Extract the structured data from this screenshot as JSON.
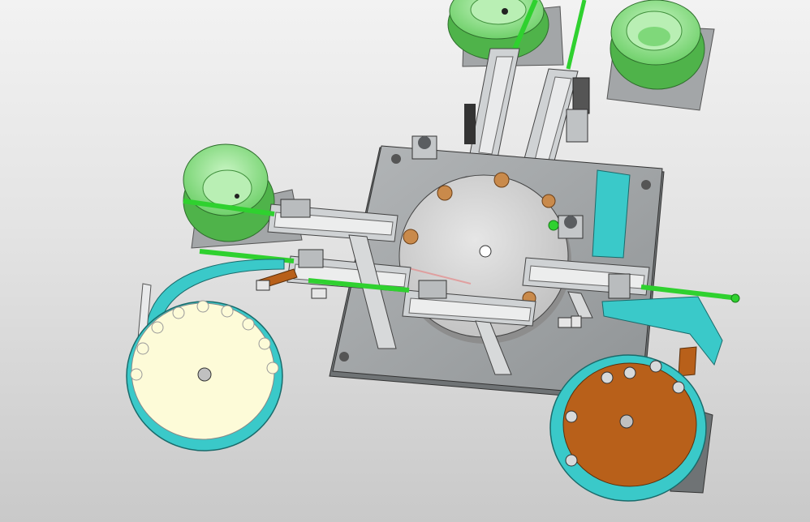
{
  "scene": {
    "subject": "",
    "colors": {
      "background_top": "#f2f2f2",
      "background_bottom": "#c9c9c9",
      "bowl_green": "#8fe08a",
      "bowl_green_dark": "#4fb34a",
      "cyan_part": "#3ac9c9",
      "cream_disc": "#fdfbd8",
      "copper_disc": "#b8601a",
      "steel_plate": "#9fa3a6",
      "turntable": "#d3d3d3",
      "guide_rail_green": "#2fd12f",
      "bronze_part": "#c98a4b"
    },
    "icons": []
  }
}
